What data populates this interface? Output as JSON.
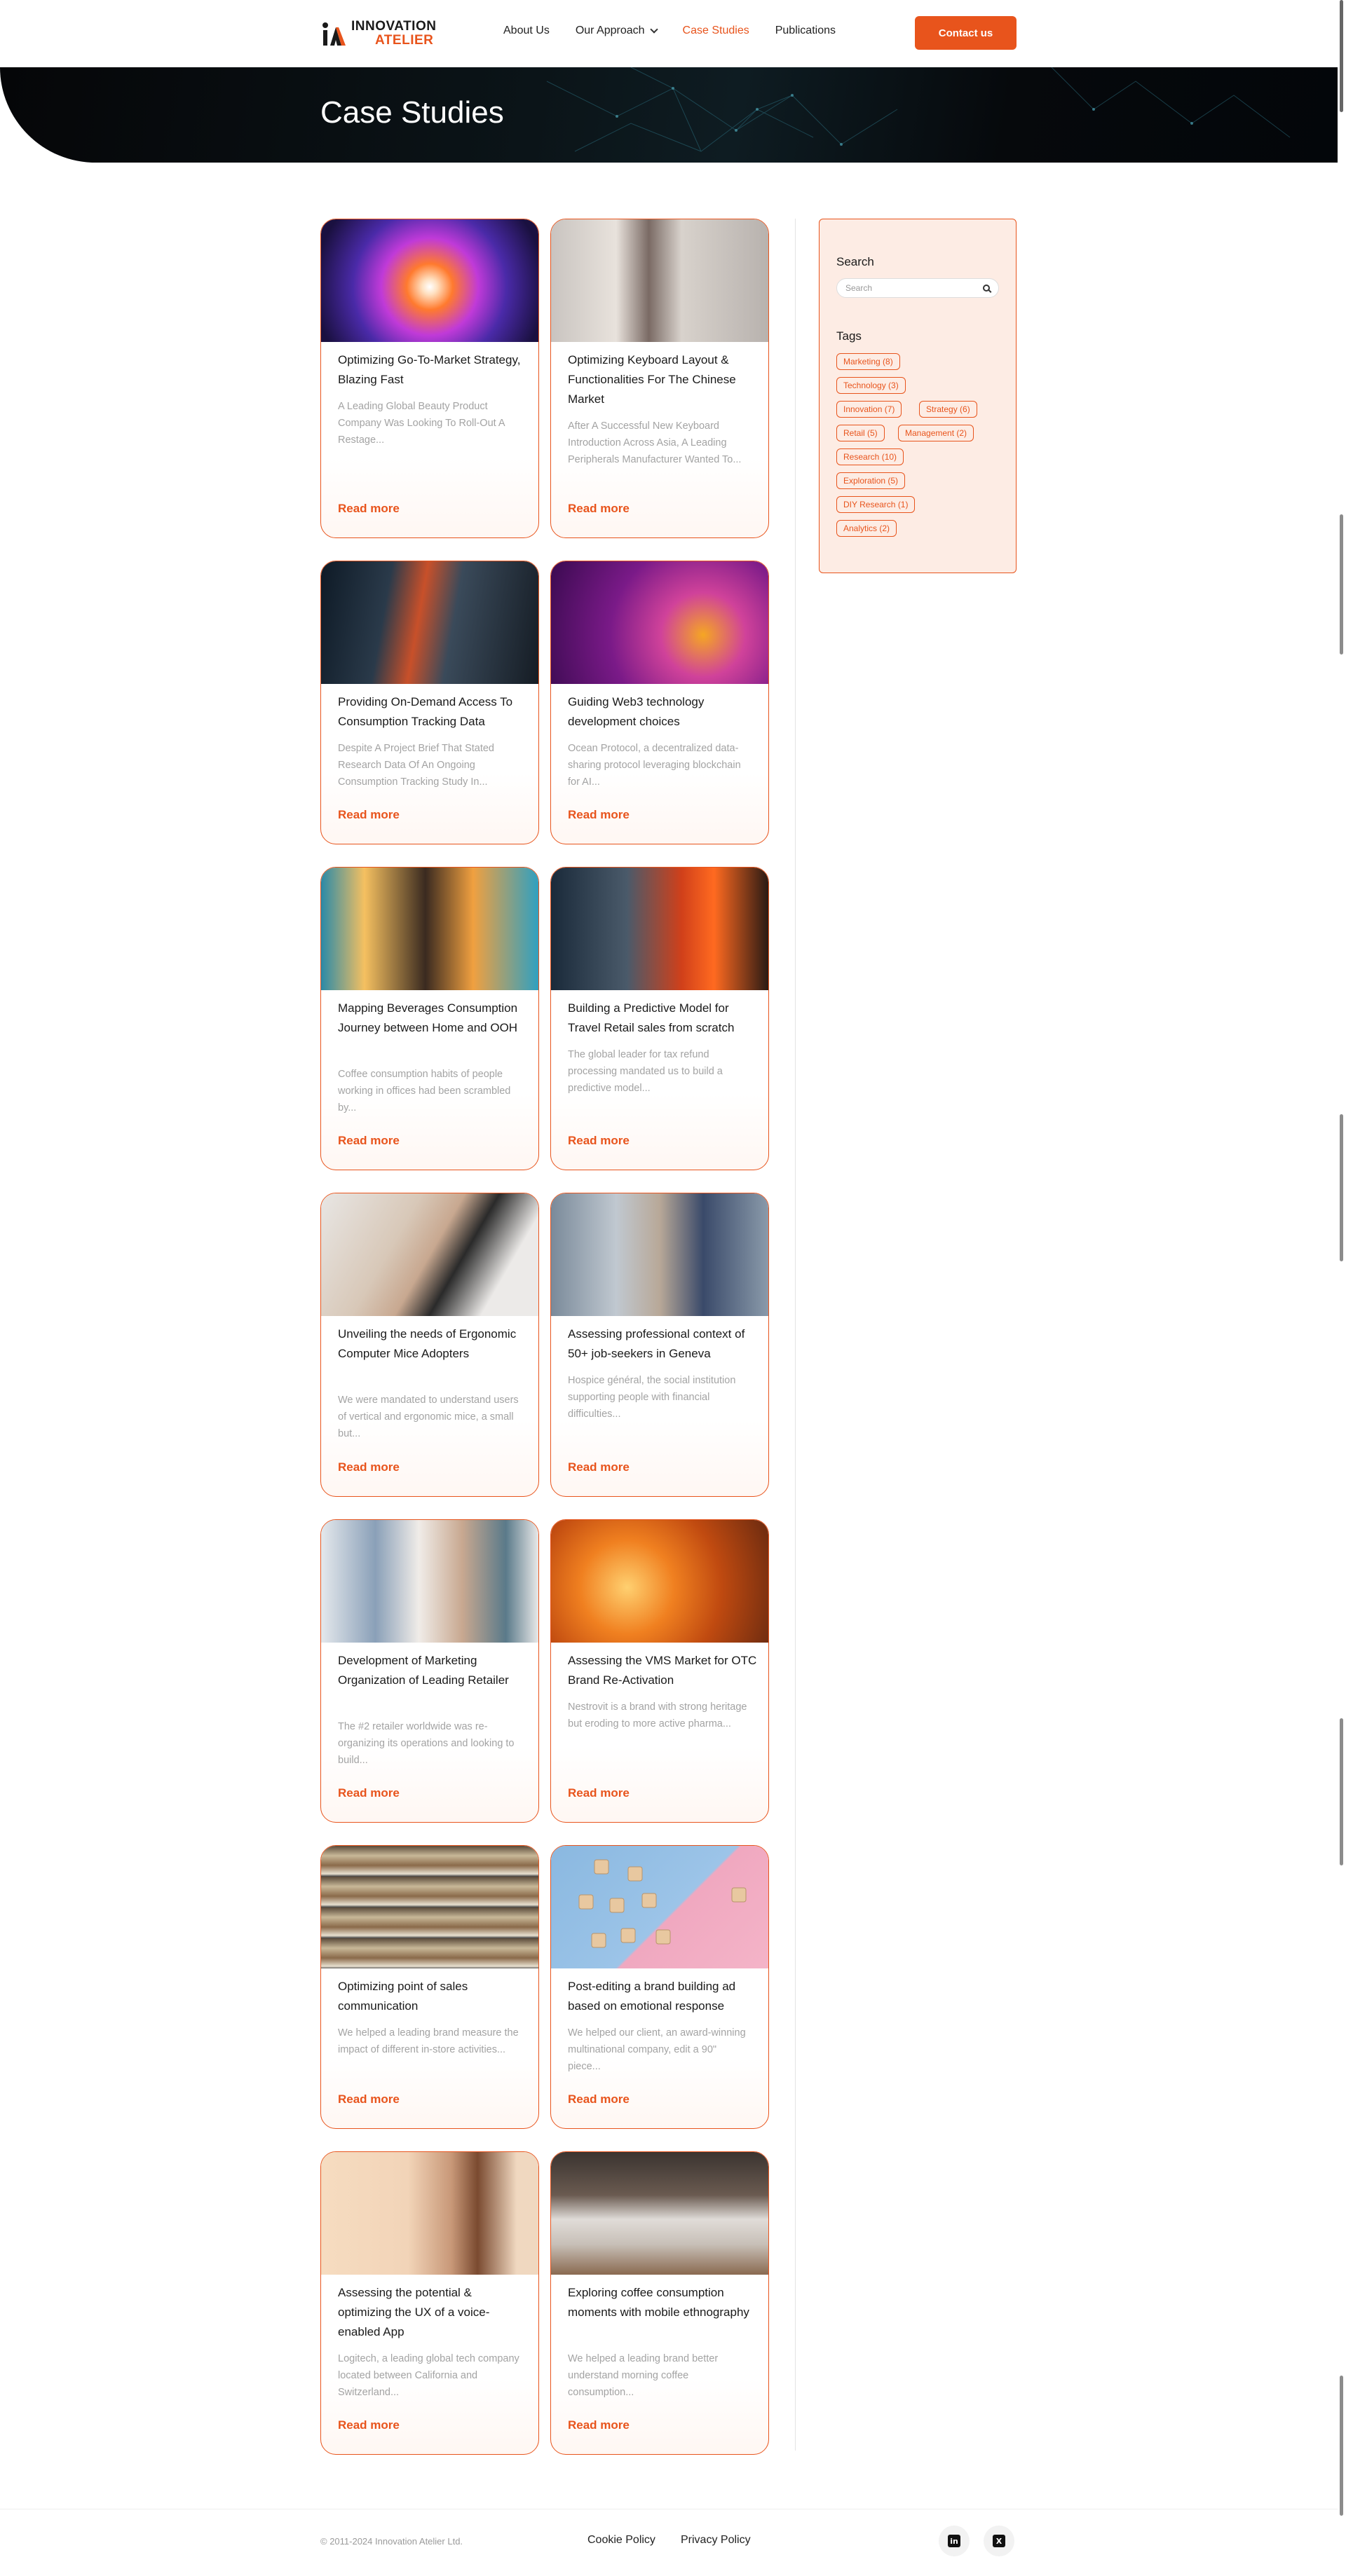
{
  "brand": {
    "line1": "INNOVATION",
    "line2": "ATELIER"
  },
  "nav": {
    "items": [
      "About Us",
      "Our Approach",
      "Case Studies",
      "Publications"
    ],
    "active": "Case Studies",
    "contact_label": "Contact us"
  },
  "hero": {
    "title": "Case Studies"
  },
  "cards": [
    {
      "title": "Optimizing Go-To-Market Strategy, Blazing Fast",
      "desc": "A Leading Global Beauty Product Company Was Looking To Roll-Out A Restage...",
      "read": "Read more"
    },
    {
      "title": "Optimizing Keyboard Layout & Functionalities For The Chinese Market",
      "desc": "After A Successful New Keyboard Introduction Across Asia, A Leading Peripherals Manufacturer Wanted To...",
      "read": "Read more"
    },
    {
      "title": "Providing On-Demand Access To Consumption Tracking Data",
      "desc": "Despite A Project Brief That Stated Research Data Of An Ongoing Consumption Tracking Study In...",
      "read": "Read more"
    },
    {
      "title": "Guiding Web3 technology development choices",
      "desc": "Ocean Protocol, a decentralized data-sharing protocol leveraging blockchain for AI...",
      "read": "Read more"
    },
    {
      "title": "Mapping Beverages Consumption Journey between Home and OOH",
      "desc": "Coffee consumption habits of people working in offices had been scrambled by...",
      "read": "Read more"
    },
    {
      "title": "Building a Predictive Model for Travel Retail sales from scratch",
      "desc": "The global leader for tax refund processing mandated us to build a predictive model...",
      "read": "Read more"
    },
    {
      "title": "Unveiling the needs of Ergonomic Computer Mice Adopters",
      "desc": "We were mandated to understand users of vertical and ergonomic mice, a small but...",
      "read": "Read more"
    },
    {
      "title": "Assessing professional context of 50+ job-seekers in Geneva",
      "desc": "Hospice général, the social institution supporting people with financial difficulties...",
      "read": "Read more"
    },
    {
      "title": "Development of Marketing Organization of Leading Retailer",
      "desc": "The #2 retailer worldwide was re-organizing its operations and looking to build...",
      "read": "Read more"
    },
    {
      "title": "Assessing the VMS Market for OTC Brand Re-Activation",
      "desc": "Nestrovit is a brand with strong heritage but eroding to more active pharma...",
      "read": "Read more"
    },
    {
      "title": "Optimizing point of sales communication",
      "desc": "We helped a leading brand measure the impact of different in-store activities...",
      "read": "Read more"
    },
    {
      "title": "Post-editing a brand building ad based on emotional response",
      "desc": "We helped our client, an award-winning multinational company, edit a 90\" piece...",
      "read": "Read more"
    },
    {
      "title": "Assessing the potential & optimizing the UX of a voice-enabled App",
      "desc": "Logitech, a leading global tech company located between California and Switzerland...",
      "read": "Read more"
    },
    {
      "title": "Exploring coffee consumption moments with mobile ethnography",
      "desc": "We helped a leading brand better understand morning coffee consumption...",
      "read": "Read more"
    }
  ],
  "sidebar": {
    "search_heading": "Search",
    "search_placeholder": "Search",
    "tags_heading": "Tags",
    "tags": [
      "Marketing (8)",
      "Technology (3)",
      "Innovation (7)",
      "Strategy (6)",
      "Retail (5)",
      "Management (2)",
      "Research (10)",
      "Exploration (5)",
      "DIY Research (1)",
      "Analytics (2)"
    ]
  },
  "footer": {
    "copyright": "© 2011-2024 Innovation Atelier Ltd.",
    "links": [
      "Cookie Policy",
      "Privacy Policy"
    ],
    "social": [
      "linkedin-icon",
      "x-icon"
    ]
  },
  "colors": {
    "accent": "#e8541c",
    "sidebar_bg": "#fdece4",
    "hero_bg": "#0b1418"
  }
}
